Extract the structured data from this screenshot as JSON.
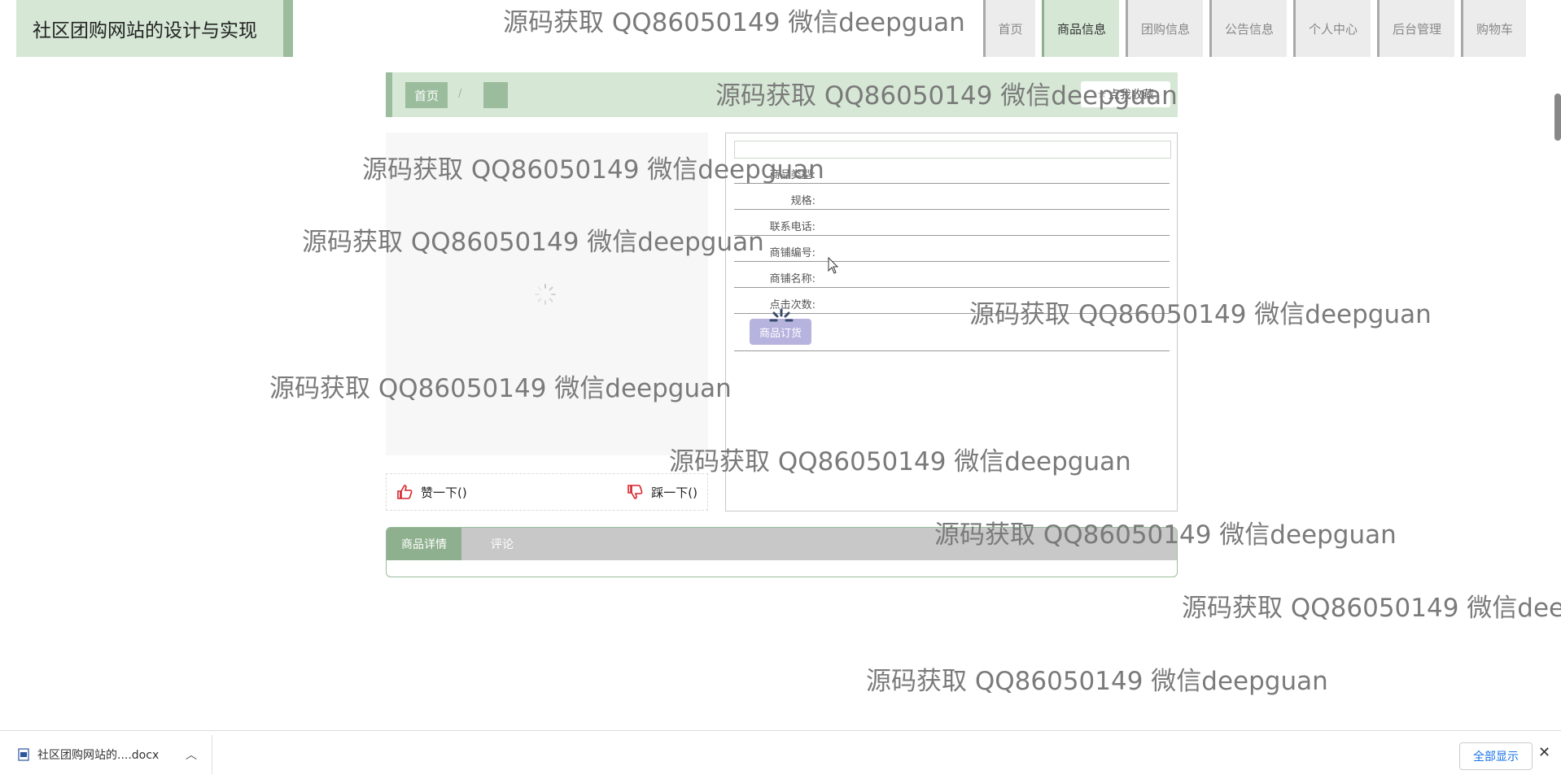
{
  "header": {
    "site_title": "社区团购网站的设计与实现",
    "nav": [
      "首页",
      "商品信息",
      "团购信息",
      "公告信息",
      "个人中心",
      "后台管理",
      "购物车"
    ],
    "active_nav": "商品信息"
  },
  "breadcrumb": {
    "home": "首页",
    "separator": "/",
    "current": ""
  },
  "favorite_button": "点我收藏",
  "product": {
    "title": "",
    "fields": [
      {
        "label": "商品类型:",
        "value": ""
      },
      {
        "label": "规格:",
        "value": ""
      },
      {
        "label": "联系电话:",
        "value": ""
      },
      {
        "label": "商铺编号:",
        "value": ""
      },
      {
        "label": "商铺名称:",
        "value": ""
      },
      {
        "label": "点击次数:",
        "value": ""
      }
    ],
    "buy_button": "商品订货"
  },
  "reactions": {
    "like": "赞一下()",
    "dislike": "踩一下()"
  },
  "tabs": [
    "商品详情",
    "评论"
  ],
  "watermark": "源码获取 QQ86050149 微信deepguan",
  "download_bar": {
    "file_name": "社区团购网站的....docx",
    "show_all": "全部显示"
  },
  "colors": {
    "accent_green": "#9bbd9d",
    "light_green": "#d6e8d5",
    "buy_button": "#b7b3df",
    "like_red": "#d9232d"
  }
}
